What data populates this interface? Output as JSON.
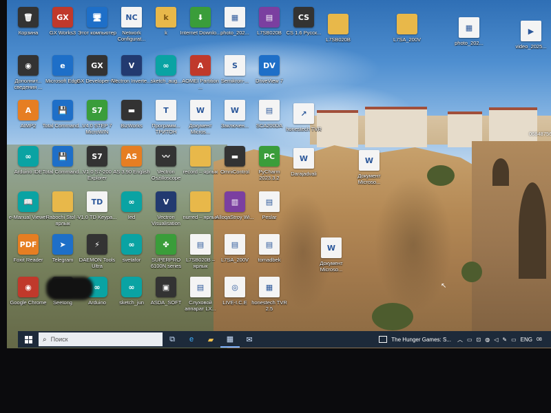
{
  "desktop": {
    "icons": [
      {
        "label": "Корзина",
        "glyph": "🗑",
        "style": "g-dark"
      },
      {
        "label": "GX Works3",
        "glyph": "GX",
        "style": "g-red"
      },
      {
        "label": "Этот компьютер",
        "glyph": "🖥",
        "style": "g-blue"
      },
      {
        "label": "Network Configurat...",
        "glyph": "NC",
        "style": "g-doc"
      },
      {
        "label": "k",
        "glyph": "k",
        "style": "g-folder"
      },
      {
        "label": "Internet Downlo...",
        "glyph": "⬇",
        "style": "g-green"
      },
      {
        "label": "photo_202...",
        "glyph": "▦",
        "style": "g-doc"
      },
      {
        "label": "L7SB020B",
        "glyph": "▤",
        "style": "g-purple"
      },
      {
        "label": "CS 1.6 Русск...",
        "glyph": "CS",
        "style": "g-dark"
      },
      {
        "label": "L7SB020B",
        "glyph": "",
        "style": "g-folder"
      },
      {
        "label": "L7SA_200V",
        "glyph": "",
        "style": "g-folder"
      },
      {
        "label": "photo_202...",
        "glyph": "▦",
        "style": "g-doc"
      },
      {
        "label": "video_2025...",
        "glyph": "▶",
        "style": "g-doc"
      },
      {
        "label": "Дополнит... сведения ...",
        "glyph": "◉",
        "style": "g-dark"
      },
      {
        "label": "Microsoft Edge",
        "glyph": "e",
        "style": "g-blue"
      },
      {
        "label": "GX Developer-FX",
        "glyph": "GX",
        "style": "g-dark"
      },
      {
        "label": "Vectron Inverte...",
        "glyph": "V",
        "style": "g-navy"
      },
      {
        "label": "sketch_aug...",
        "glyph": "∞",
        "style": "g-teal"
      },
      {
        "label": "AOMEI Partition ...",
        "glyph": "A",
        "style": "g-red"
      },
      {
        "label": "Semikron-...",
        "glyph": "S",
        "style": "g-doc"
      },
      {
        "label": "DriveView 7",
        "glyph": "DV",
        "style": "g-blue"
      },
      {
        "label": "AIMP2",
        "glyph": "A",
        "style": "g-orange"
      },
      {
        "label": "Total Command...",
        "glyph": "💾",
        "style": "g-blue"
      },
      {
        "label": "V4.0 STEP 7 MicroWIN",
        "glyph": "S7",
        "style": "g-green"
      },
      {
        "label": "BizWorks",
        "glyph": "▬",
        "style": "g-dark"
      },
      {
        "label": "Программ... ТРИТОН",
        "glyph": "T",
        "style": "g-doc"
      },
      {
        "label": "Документ Micros...",
        "glyph": "W",
        "style": "g-doc"
      },
      {
        "label": "Заключен...",
        "glyph": "W",
        "style": "g-doc"
      },
      {
        "label": "SCA200DA",
        "glyph": "▤",
        "style": "g-doc"
      },
      {
        "label": "honestech TVR",
        "glyph": "↗",
        "style": "g-doc"
      },
      {
        "label": "Arduino IDE",
        "glyph": "∞",
        "style": "g-teal"
      },
      {
        "label": "Total Command...",
        "glyph": "💾",
        "style": "g-blue"
      },
      {
        "label": "V1.0 S7-200 Explorer",
        "glyph": "S7",
        "style": "g-dark"
      },
      {
        "label": "AS 3.90 English",
        "glyph": "AS",
        "style": "g-orange"
      },
      {
        "label": "Vectron Oszilloscope",
        "glyph": "〰",
        "style": "g-dark"
      },
      {
        "label": "record – ярлык",
        "glyph": "",
        "style": "g-folder"
      },
      {
        "label": "OmniControl",
        "glyph": "▬",
        "style": "g-dark"
      },
      {
        "label": "PyCharm 2023.3.2",
        "glyph": "PC",
        "style": "g-green"
      },
      {
        "label": "Darajadvali",
        "glyph": "W",
        "style": "g-doc"
      },
      {
        "label": "Документ Microsо...",
        "glyph": "W",
        "style": "g-doc"
      },
      {
        "label": "e-Manual Viewer",
        "glyph": "📖",
        "style": "g-teal"
      },
      {
        "label": "Rabochi Stol – ярлык",
        "glyph": "",
        "style": "g-folder"
      },
      {
        "label": "V1.0 TD Keypa...",
        "glyph": "TD",
        "style": "g-doc"
      },
      {
        "label": "Ied",
        "glyph": "∞",
        "style": "g-teal"
      },
      {
        "label": "Vectron Visualisation",
        "glyph": "V",
        "style": "g-navy"
      },
      {
        "label": "nurred – ярлык",
        "glyph": "",
        "style": "g-folder"
      },
      {
        "label": "AlloqaStroy Wi...",
        "glyph": "▥",
        "style": "g-purple"
      },
      {
        "label": "Peslar",
        "glyph": "▤",
        "style": "g-doc"
      },
      {
        "label": "Foxit Reader",
        "glyph": "PDF",
        "style": "g-orange"
      },
      {
        "label": "Telegram",
        "glyph": "➤",
        "style": "g-blue"
      },
      {
        "label": "DAEMON Tools Ultra",
        "glyph": "⚡",
        "style": "g-dark"
      },
      {
        "label": "svetafor",
        "glyph": "∞",
        "style": "g-teal"
      },
      {
        "label": "SUPERPRO 6100N series",
        "glyph": "✤",
        "style": "g-green"
      },
      {
        "label": "L7SB020B – ярлык",
        "glyph": "▤",
        "style": "g-doc"
      },
      {
        "label": "L7SA_200V",
        "glyph": "▤",
        "style": "g-doc"
      },
      {
        "label": "tomadbek",
        "glyph": "▤",
        "style": "g-doc"
      },
      {
        "label": "Документ Microso...",
        "glyph": "W",
        "style": "g-doc"
      },
      {
        "label": "Google Chrome",
        "glyph": "◉",
        "style": "g-red"
      },
      {
        "label": "Seetong",
        "glyph": "◉",
        "style": "g-dark"
      },
      {
        "label": "Arduino",
        "glyph": "∞",
        "style": "g-teal"
      },
      {
        "label": "sketch_jun",
        "glyph": "∞",
        "style": "g-teal"
      },
      {
        "label": "ASDA_SOFT",
        "glyph": "▣",
        "style": "g-dark"
      },
      {
        "label": "Слуховой аппарат LX...",
        "glyph": "▤",
        "style": "g-doc"
      },
      {
        "label": "LIVE-I.C.E",
        "glyph": "◎",
        "style": "g-doc"
      },
      {
        "label": "honestech TVR 2.5",
        "glyph": "▦",
        "style": "g-doc"
      }
    ],
    "wallpaper_note": "",
    "partial_label": "0684875686-..."
  },
  "taskbar": {
    "search_placeholder": "Поиск",
    "media_title": "The Hunger Games: S...",
    "language": "ENG",
    "clock": "08"
  },
  "colors": {
    "taskbar_bg": "#1d2a3a",
    "accent": "#7fb2ff"
  }
}
